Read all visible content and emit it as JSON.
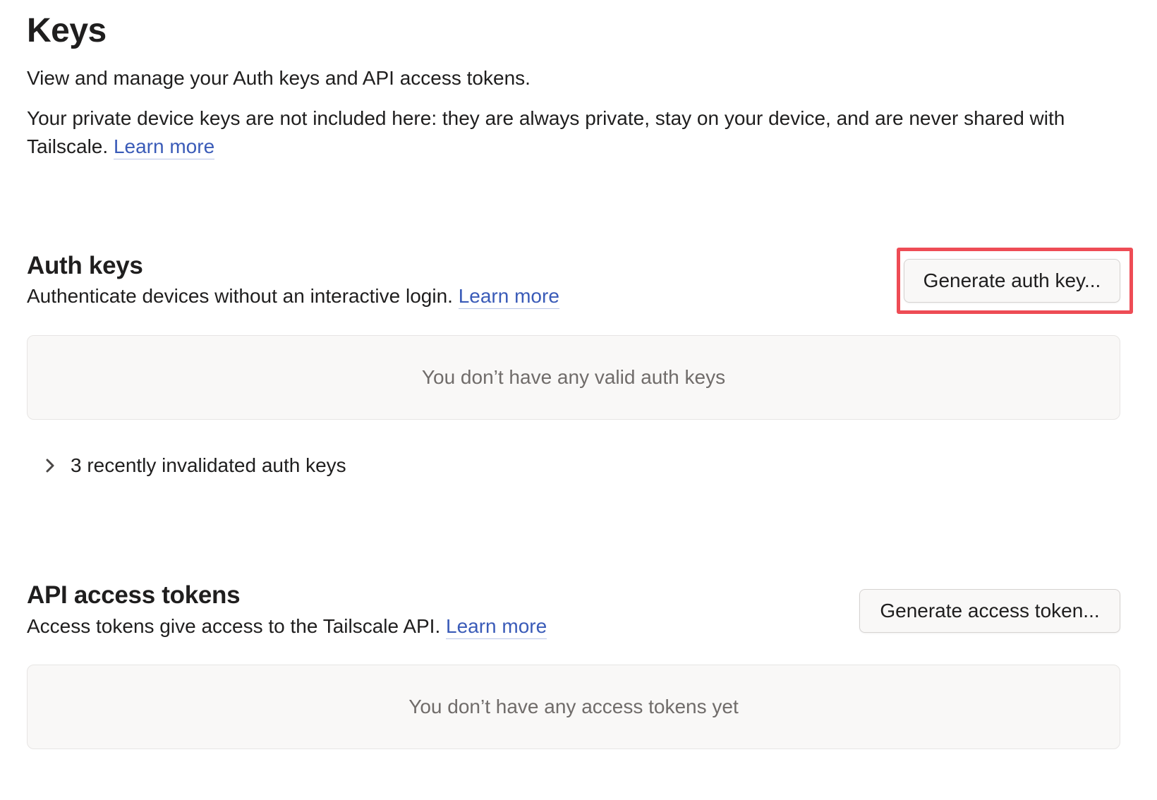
{
  "page": {
    "title": "Keys",
    "intro": "View and manage your Auth keys and API access tokens.",
    "private_note": "Your private device keys are not included here: they are always private, stay on your device, and are never shared with Tailscale.",
    "private_note_link": "Learn more"
  },
  "auth_keys": {
    "title": "Auth keys",
    "description": "Authenticate devices without an interactive login.",
    "learn_more": "Learn more",
    "generate_button": "Generate auth key...",
    "empty_message": "You don’t have any valid auth keys",
    "invalidated_toggle": "3 recently invalidated auth keys"
  },
  "api_tokens": {
    "title": "API access tokens",
    "description": "Access tokens give access to the Tailscale API.",
    "learn_more": "Learn more",
    "generate_button": "Generate access token...",
    "empty_message": "You don’t have any access tokens yet"
  },
  "icons": {
    "disclosure": "chevron-right-icon"
  },
  "colors": {
    "link": "#3a5bb8",
    "highlight": "#ee4c55"
  }
}
